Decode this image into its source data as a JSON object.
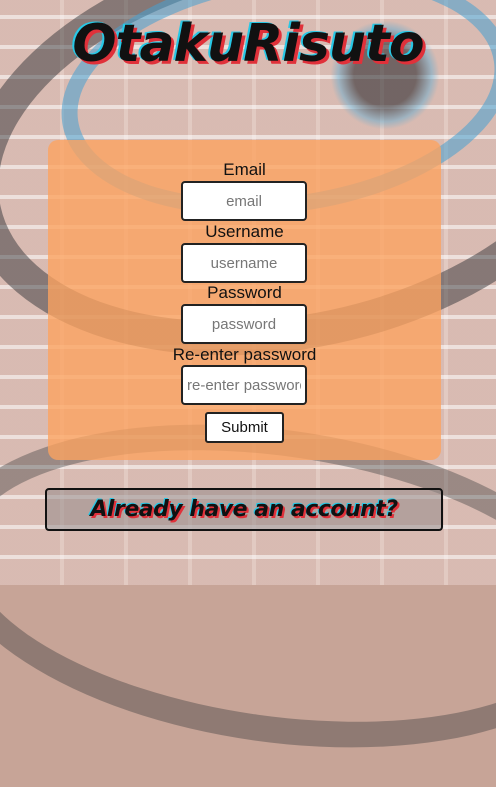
{
  "app": {
    "title": "OtakuRisuto"
  },
  "form": {
    "fields": [
      {
        "label": "Email",
        "placeholder": "email",
        "value": ""
      },
      {
        "label": "Username",
        "placeholder": "username",
        "value": ""
      },
      {
        "label": "Password",
        "placeholder": "password",
        "value": ""
      },
      {
        "label": "Re-enter password",
        "placeholder": "re-enter password",
        "value": ""
      }
    ],
    "submit_label": "Submit"
  },
  "login_link": {
    "label": "Already have an account?"
  },
  "colors": {
    "card": "#fda35f",
    "title_shadow_red": "#e0313a",
    "title_shadow_cyan": "#27c8e6"
  }
}
